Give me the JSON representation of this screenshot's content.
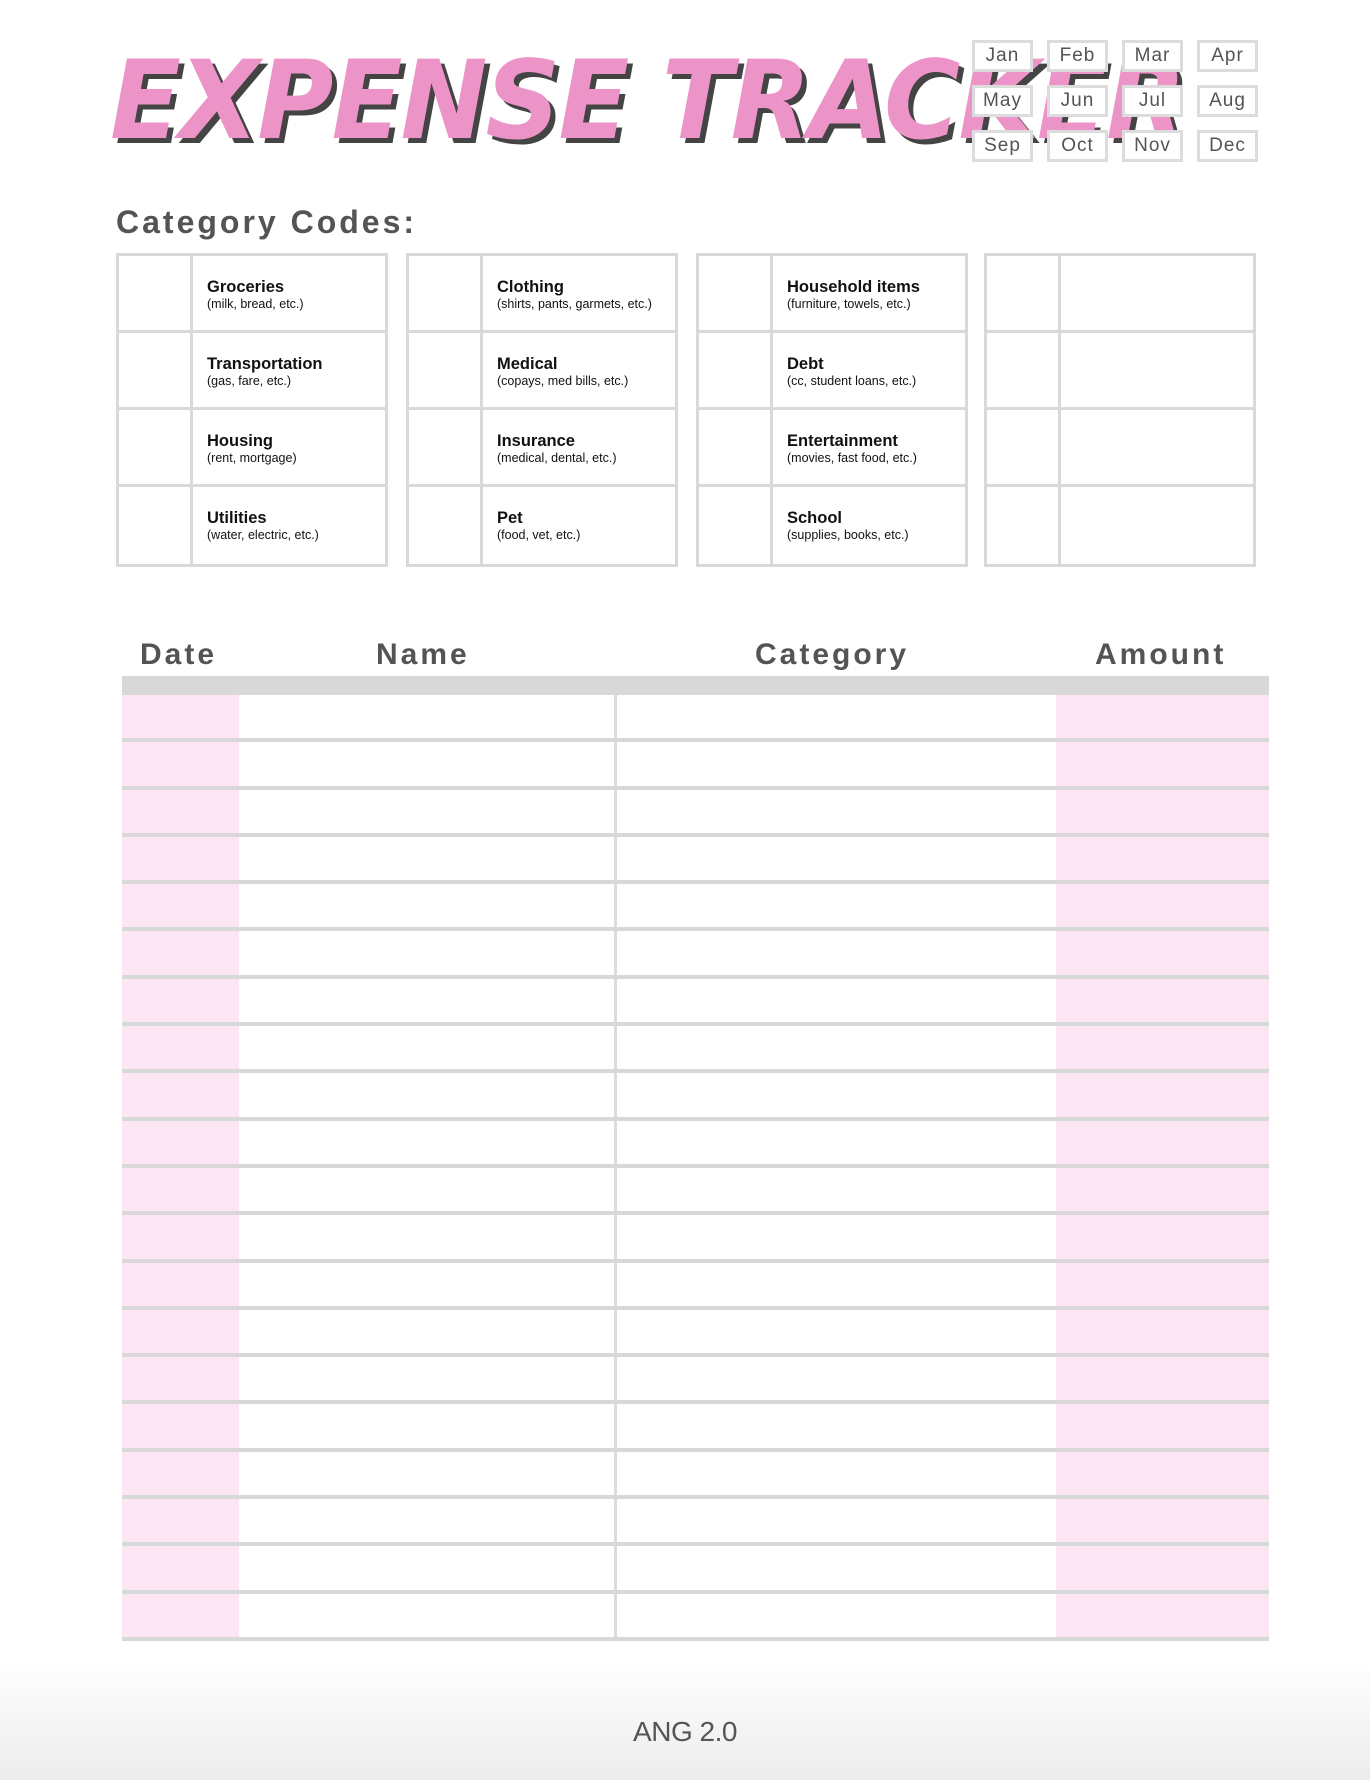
{
  "title": "Expense Tracker",
  "colors": {
    "title_pink": "#ec93c8",
    "title_shadow": "#444444",
    "column_pink": "#fce6f3",
    "grid_gray": "#d8d8d8",
    "text_gray": "#545454"
  },
  "months": [
    "Jan",
    "Feb",
    "Mar",
    "Apr",
    "May",
    "Jun",
    "Jul",
    "Aug",
    "Sep",
    "Oct",
    "Nov",
    "Dec"
  ],
  "category_codes": {
    "heading": "Category Codes:",
    "groups": [
      [
        {
          "name": "Groceries",
          "desc": "(milk, bread, etc.)"
        },
        {
          "name": "Transportation",
          "desc": "(gas, fare, etc.)"
        },
        {
          "name": "Housing",
          "desc": "(rent, mortgage)"
        },
        {
          "name": "Utilities",
          "desc": "(water, electric, etc.)"
        }
      ],
      [
        {
          "name": "Clothing",
          "desc": "(shirts, pants, garmets, etc.)"
        },
        {
          "name": "Medical",
          "desc": "(copays, med bills, etc.)"
        },
        {
          "name": "Insurance",
          "desc": "(medical, dental, etc.)"
        },
        {
          "name": "Pet",
          "desc": "(food, vet, etc.)"
        }
      ],
      [
        {
          "name": "Household items",
          "desc": "(furniture, towels, etc.)"
        },
        {
          "name": "Debt",
          "desc": "(cc, student loans, etc.)"
        },
        {
          "name": "Entertainment",
          "desc": "(movies, fast food, etc.)"
        },
        {
          "name": "School",
          "desc": "(supplies, books, etc.)"
        }
      ],
      [
        {
          "name": "",
          "desc": ""
        },
        {
          "name": "",
          "desc": ""
        },
        {
          "name": "",
          "desc": ""
        },
        {
          "name": "",
          "desc": ""
        }
      ]
    ]
  },
  "table": {
    "columns": [
      "Date",
      "Name",
      "Category",
      "Amount"
    ],
    "row_count": 20,
    "rows": []
  },
  "footer": "ANG 2.0"
}
